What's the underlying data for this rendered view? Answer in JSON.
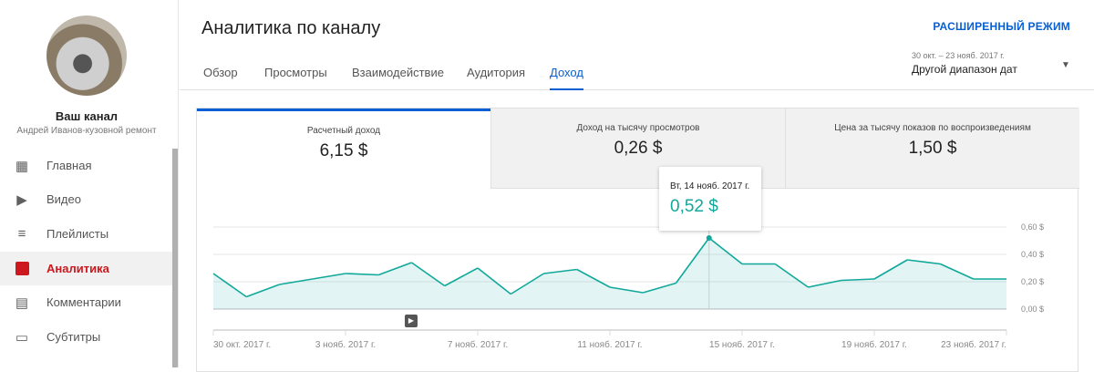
{
  "sidebar": {
    "channel_title": "Ваш канал",
    "channel_name": "Андрей Иванов-кузовной ремонт",
    "items": [
      {
        "label": "Главная",
        "icon": "dashboard-icon"
      },
      {
        "label": "Видео",
        "icon": "video-icon"
      },
      {
        "label": "Плейлисты",
        "icon": "playlist-icon"
      },
      {
        "label": "Аналитика",
        "icon": "analytics-icon"
      },
      {
        "label": "Комментарии",
        "icon": "comment-icon"
      },
      {
        "label": "Субтитры",
        "icon": "subtitles-icon"
      }
    ]
  },
  "header": {
    "title": "Аналитика по каналу",
    "advanced": "РАСШИРЕННЫЙ РЕЖИМ",
    "tabs": [
      "Обзор",
      "Просмотры",
      "Взаимодействие",
      "Аудитория",
      "Доход"
    ],
    "range_dates": "30 окт. – 23 нояб. 2017 г.",
    "range_label": "Другой диапазон дат"
  },
  "metrics": [
    {
      "label": "Расчетный доход",
      "value": "6,15 $"
    },
    {
      "label": "Доход на тысячу просмотров",
      "value": "0,26 $"
    },
    {
      "label": "Цена за тысячу показов по воспроизведениям",
      "value": "1,50 $"
    }
  ],
  "tooltip": {
    "date": "Вт, 14 нояб. 2017 г.",
    "value": "0,52 $"
  },
  "colors": {
    "accent": "#065fd4",
    "line": "#10a89a",
    "active": "#cc181e"
  },
  "chart_data": {
    "type": "area",
    "title": "Расчетный доход",
    "ylim": [
      0,
      0.6
    ],
    "yticks": [
      "0,00 $",
      "0,20 $",
      "0,40 $",
      "0,60 $"
    ],
    "xticks": [
      "30 окт. 2017 г.",
      "3 нояб. 2017 г.",
      "7 нояб. 2017 г.",
      "11 нояб. 2017 г.",
      "15 нояб. 2017 г.",
      "19 нояб. 2017 г.",
      "23 нояб. 2017 г."
    ],
    "values": [
      0.26,
      0.09,
      0.18,
      0.22,
      0.26,
      0.25,
      0.34,
      0.17,
      0.3,
      0.11,
      0.26,
      0.29,
      0.16,
      0.12,
      0.19,
      0.52,
      0.33,
      0.33,
      0.16,
      0.21,
      0.22,
      0.36,
      0.33,
      0.22,
      0.22
    ],
    "highlight_index": 15
  }
}
